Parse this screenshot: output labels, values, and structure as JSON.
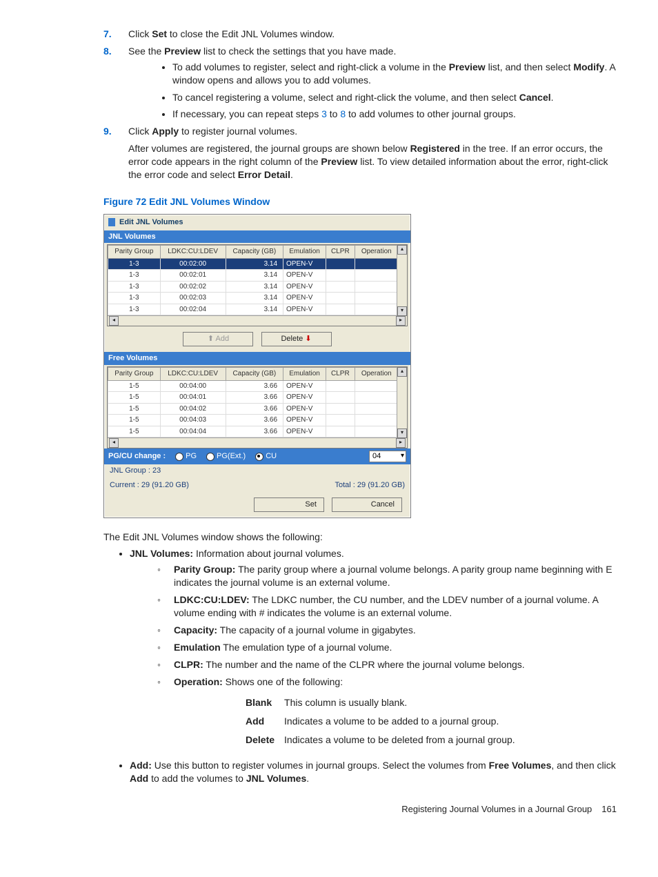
{
  "steps": {
    "s7": {
      "num": "7.",
      "textA": "Click ",
      "bold": "Set",
      "textB": " to close the Edit JNL Volumes window."
    },
    "s8": {
      "num": "8.",
      "textA": "See the ",
      "bold": "Preview",
      "textB": " list to check the settings that you have made."
    },
    "s8_bul1": {
      "a": "To add volumes to register, select and right-click a volume in the ",
      "b": "Preview",
      "c": " list, and then select ",
      "d": "Modify",
      "e": ". A window opens and allows you to add volumes."
    },
    "s8_bul2": {
      "a": "To cancel registering a volume, select and right-click the volume, and then select ",
      "b": "Cancel",
      "c": "."
    },
    "s8_bul3": {
      "a": "If necessary, you can repeat steps ",
      "n1": "3",
      "mid": " to ",
      "n2": "8",
      "b": " to add volumes to other journal groups."
    },
    "s9": {
      "num": "9.",
      "textA": "Click ",
      "bold": "Apply",
      "textB": " to register journal volumes."
    },
    "s9_after": {
      "a": "After volumes are registered, the journal groups are shown below ",
      "b": "Registered",
      "c": " in the tree. If an error occurs, the error code appears in the right column of the ",
      "d": "Preview",
      "e": " list. To view detailed information about the error, right-click the error code and select ",
      "f": "Error Detail",
      "g": "."
    }
  },
  "fig_caption": "Figure 72 Edit JNL Volumes Window",
  "dialog": {
    "title": "Edit JNL Volumes",
    "jnl_label": "JNL Volumes",
    "free_label": "Free Volumes",
    "headers": [
      "Parity Group",
      "LDKC:CU:LDEV",
      "Capacity (GB)",
      "Emulation",
      "CLPR",
      "Operation"
    ],
    "jnl_rows": [
      {
        "pg": "1-3",
        "ld": "00:02:00",
        "cap": "3.14",
        "emu": "OPEN-V",
        "clpr": "",
        "op": "",
        "sel": true
      },
      {
        "pg": "1-3",
        "ld": "00:02:01",
        "cap": "3.14",
        "emu": "OPEN-V",
        "clpr": "",
        "op": ""
      },
      {
        "pg": "1-3",
        "ld": "00:02:02",
        "cap": "3.14",
        "emu": "OPEN-V",
        "clpr": "",
        "op": ""
      },
      {
        "pg": "1-3",
        "ld": "00:02:03",
        "cap": "3.14",
        "emu": "OPEN-V",
        "clpr": "",
        "op": ""
      },
      {
        "pg": "1-3",
        "ld": "00:02:04",
        "cap": "3.14",
        "emu": "OPEN-V",
        "clpr": "",
        "op": ""
      }
    ],
    "free_rows": [
      {
        "pg": "1-5",
        "ld": "00:04:00",
        "cap": "3.66",
        "emu": "OPEN-V",
        "clpr": "",
        "op": ""
      },
      {
        "pg": "1-5",
        "ld": "00:04:01",
        "cap": "3.66",
        "emu": "OPEN-V",
        "clpr": "",
        "op": ""
      },
      {
        "pg": "1-5",
        "ld": "00:04:02",
        "cap": "3.66",
        "emu": "OPEN-V",
        "clpr": "",
        "op": ""
      },
      {
        "pg": "1-5",
        "ld": "00:04:03",
        "cap": "3.66",
        "emu": "OPEN-V",
        "clpr": "",
        "op": ""
      },
      {
        "pg": "1-5",
        "ld": "00:04:04",
        "cap": "3.66",
        "emu": "OPEN-V",
        "clpr": "",
        "op": ""
      }
    ],
    "btn_add": "Add",
    "btn_delete": "Delete",
    "pgcu_label": "PG/CU change :",
    "radio_pg": "PG",
    "radio_pgext": "PG(Ext.)",
    "radio_cu": "CU",
    "combo_val": "04",
    "jnl_group": "JNL Group : 23",
    "current": "Current : 29 (91.20 GB)",
    "total": "Total : 29 (91.20 GB)",
    "btn_set": "Set",
    "btn_cancel": "Cancel"
  },
  "intro2": "The Edit JNL Volumes window shows the following:",
  "bl1": {
    "b": "JNL Volumes:",
    "t": " Information about journal volumes."
  },
  "sub": {
    "pg": {
      "b": "Parity Group:",
      "t": " The parity group where a journal volume belongs. A parity group name beginning with E indicates the journal volume is an external volume."
    },
    "ld": {
      "b": "LDKC:CU:LDEV:",
      "t": " The LDKC number, the CU number, and the LDEV number of a journal volume. A volume ending with # indicates the volume is an external volume."
    },
    "cap": {
      "b": "Capacity:",
      "t": " The capacity of a journal volume in gigabytes."
    },
    "emu": {
      "b": "Emulation",
      "t": " The emulation type of a journal volume."
    },
    "clpr": {
      "b": "CLPR:",
      "t": " The number and the name of the CLPR where the journal volume belongs."
    },
    "op": {
      "b": "Operation:",
      "t": " Shows one of the following:"
    }
  },
  "optable": {
    "blank": {
      "k": "Blank",
      "v": "This column is usually blank."
    },
    "add": {
      "k": "Add",
      "v": "Indicates a volume to be added to a journal group."
    },
    "del": {
      "k": "Delete",
      "v": "Indicates a volume to be deleted from a journal group."
    }
  },
  "bl_add": {
    "b": "Add:",
    "a": " Use this button to register volumes in journal groups. Select the volumes from ",
    "c": "Free Volumes",
    "d": ", and then click ",
    "e": "Add",
    "f": " to add the volumes to ",
    "g": "JNL Volumes",
    "h": "."
  },
  "footer_title": "Registering Journal Volumes in a Journal Group",
  "footer_page": "161"
}
